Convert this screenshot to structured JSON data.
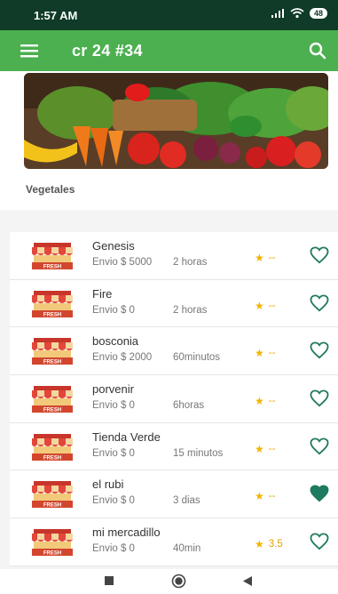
{
  "status_bar": {
    "time": "1:57 AM",
    "battery": "48"
  },
  "app_bar": {
    "title": "cr 24 #34",
    "menu_icon": "hamburger-menu-icon",
    "search_icon": "search-icon"
  },
  "banner": {
    "image": "vegetables-banner"
  },
  "category": {
    "label": "Vegetales"
  },
  "stores": [
    {
      "name": "Genesis",
      "shipping": "Envio $ 5000",
      "time": "2 horas",
      "rating": "--",
      "favorite": false
    },
    {
      "name": "Fire",
      "shipping": "Envio $ 0",
      "time": "2 horas",
      "rating": "--",
      "favorite": false
    },
    {
      "name": "bosconia",
      "shipping": "Envio $ 2000",
      "time": "60minutos",
      "rating": "--",
      "favorite": false
    },
    {
      "name": "porvenir",
      "shipping": "Envio $ 0",
      "time": "6horas",
      "rating": "--",
      "favorite": false
    },
    {
      "name": "Tienda Verde",
      "shipping": "Envio $ 0",
      "time": "15 minutos",
      "rating": "--",
      "favorite": false
    },
    {
      "name": "el rubi",
      "shipping": "Envio $ 0",
      "time": "3 dias",
      "rating": "--",
      "favorite": true
    },
    {
      "name": "mi mercadillo",
      "shipping": "Envio $ 0",
      "time": "40min",
      "rating": "3.5",
      "favorite": false
    }
  ],
  "colors": {
    "status_bar": "#0f3b28",
    "app_bar": "#4caf50",
    "heart": "#1f7a60",
    "star": "#f0b400"
  },
  "nav": {
    "icons": [
      "recents-square-icon",
      "home-circle-icon",
      "back-triangle-icon"
    ]
  }
}
